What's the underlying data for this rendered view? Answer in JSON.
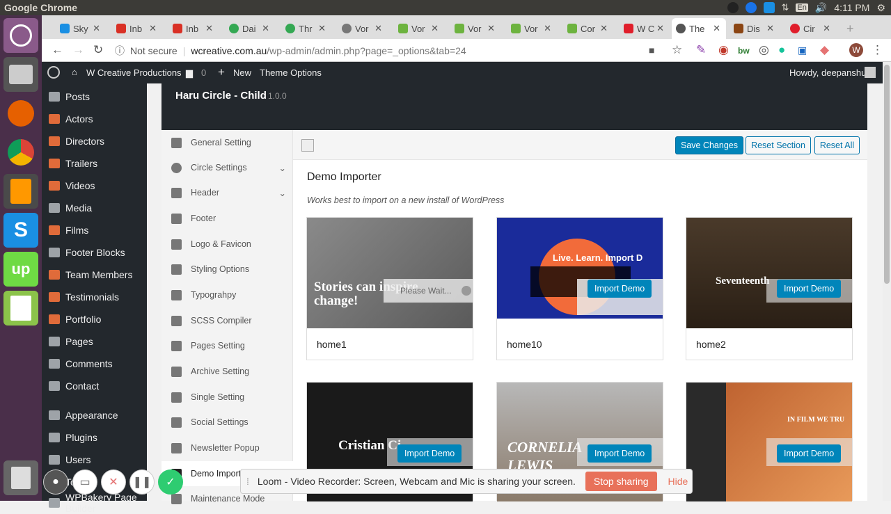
{
  "os_bar": {
    "title": "Google Chrome",
    "time": "4:11 PM",
    "lang": "En"
  },
  "tabs": [
    {
      "label": "Sky",
      "color": "#1a8fe3"
    },
    {
      "label": "Inb",
      "color": "#d93025"
    },
    {
      "label": "Inb",
      "color": "#d93025"
    },
    {
      "label": "Dai",
      "color": "#34a853"
    },
    {
      "label": "Thr",
      "color": "#34a853"
    },
    {
      "label": "Vor",
      "color": "#777777"
    },
    {
      "label": "Vor",
      "color": "#6db33f"
    },
    {
      "label": "Vor",
      "color": "#6db33f"
    },
    {
      "label": "Vor",
      "color": "#6db33f"
    },
    {
      "label": "Cor",
      "color": "#6db33f"
    },
    {
      "label": "W C",
      "color": "#e01e2b"
    },
    {
      "label": "The",
      "color": "#555555"
    },
    {
      "label": "Dis",
      "color": "#8b4513"
    },
    {
      "label": "Cir",
      "color": "#e01e2b"
    }
  ],
  "address": {
    "security": "Not secure",
    "domain": "wcreative.com.au",
    "path": "/wp-admin/admin.php?page=_options&tab=24"
  },
  "wp_admin_bar": {
    "site": "W Creative Productions",
    "comments": "0",
    "new": "New",
    "theme_options": "Theme Options",
    "howdy": "Howdy, deepanshu"
  },
  "sidebar_menu": [
    "Posts",
    "Actors",
    "Directors",
    "Trailers",
    "Videos",
    "Media",
    "Films",
    "Footer Blocks",
    "Team Members",
    "Testimonials",
    "Portfolio",
    "Pages",
    "Comments",
    "Contact",
    "Appearance",
    "Plugins",
    "Users",
    "Tools",
    "WPBakery Page Builder"
  ],
  "theme": {
    "name": "Haru Circle - Child",
    "version": "1.0.0"
  },
  "options_sections": [
    "General Setting",
    "Circle Settings",
    "Header",
    "Footer",
    "Logo & Favicon",
    "Styling Options",
    "Typograhpy",
    "SCSS Compiler",
    "Pages Setting",
    "Archive Setting",
    "Single Setting",
    "Social Settings",
    "Newsletter Popup",
    "Demo Importer",
    "Maintenance Mode"
  ],
  "buttons": {
    "save": "Save Changes",
    "reset_section": "Reset Section",
    "reset_all": "Reset All",
    "import": "Import Demo"
  },
  "demo_importer": {
    "title": "Demo Importer",
    "subtitle": "Works best to import on a new install of WordPress",
    "please_wait": "Please Wait...",
    "demos": [
      {
        "name": "home1",
        "caption": "Stories can inspire change!"
      },
      {
        "name": "home10",
        "caption": "Live. Learn. Import D"
      },
      {
        "name": "home2",
        "caption": "Seventeenth"
      },
      {
        "name": "",
        "caption": "Cristian Ci"
      },
      {
        "name": "",
        "caption": "CORNELIA LEWIS"
      },
      {
        "name": "",
        "caption": "IN FILM WE TRU"
      }
    ]
  },
  "loom": {
    "message": "Loom - Video Recorder: Screen, Webcam and Mic is sharing your screen.",
    "stop": "Stop sharing",
    "hide": "Hide"
  }
}
